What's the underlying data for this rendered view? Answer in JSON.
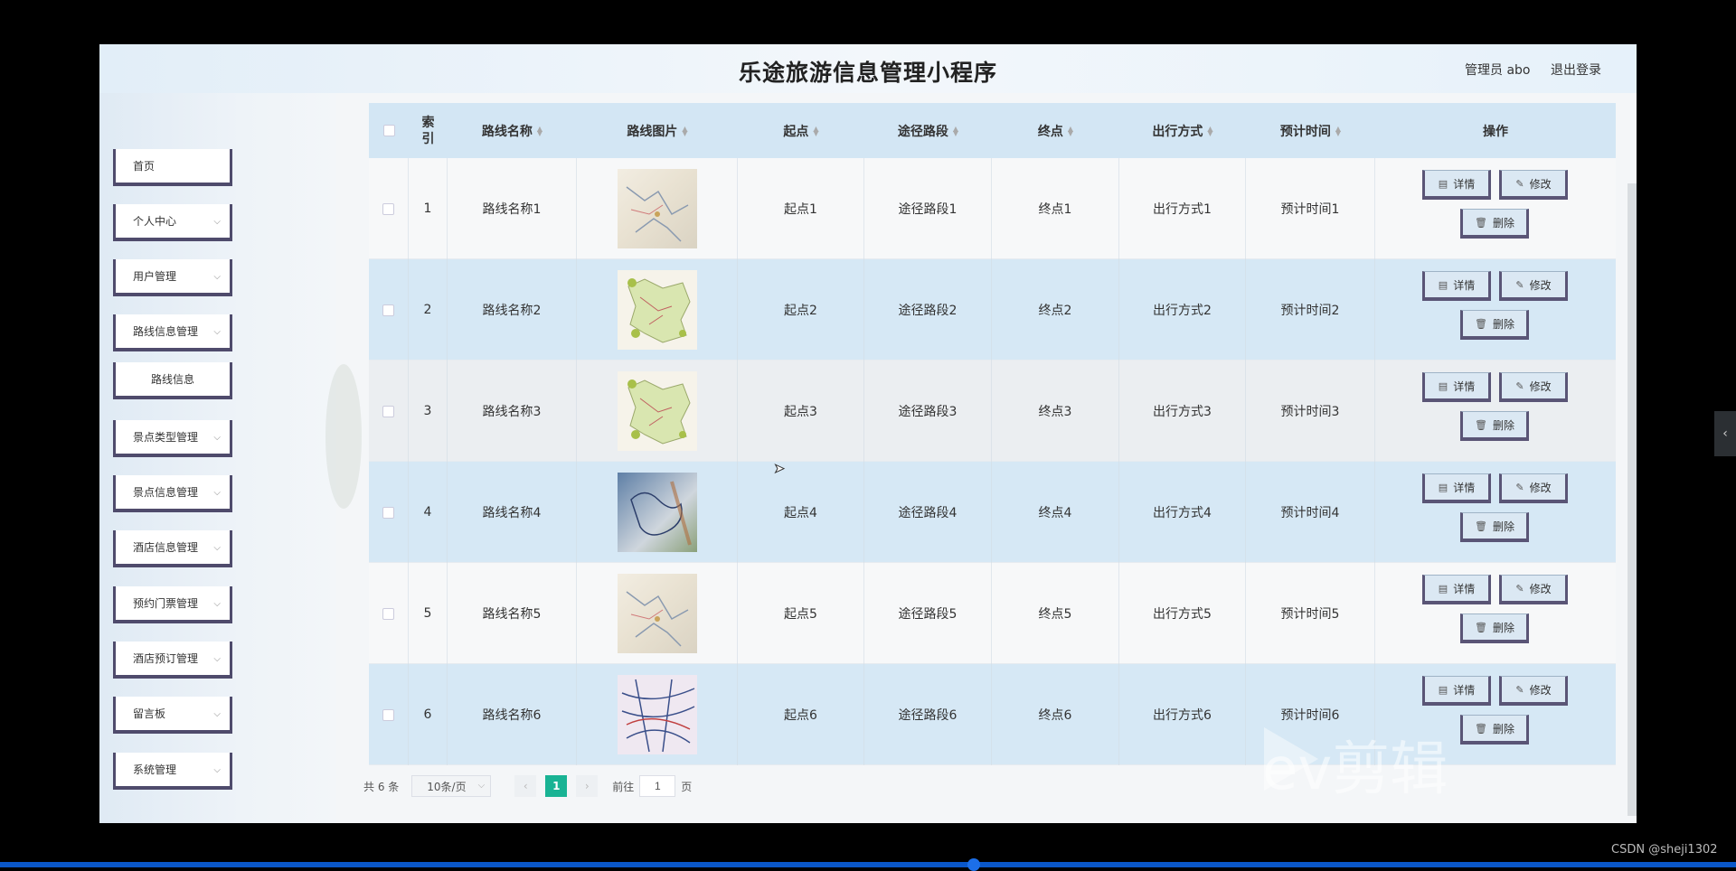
{
  "app_title": "乐途旅游信息管理小程序",
  "header": {
    "admin_label": "管理员 abo",
    "logout_label": "退出登录"
  },
  "sidebar": {
    "items": [
      {
        "label": "首页",
        "has_chevron": false
      },
      {
        "label": "个人中心",
        "has_chevron": true
      },
      {
        "label": "用户管理",
        "has_chevron": true
      },
      {
        "label": "路线信息管理",
        "has_chevron": true
      },
      {
        "label": "路线信息",
        "has_chevron": false,
        "sub": true
      },
      {
        "label": "景点类型管理",
        "has_chevron": true
      },
      {
        "label": "景点信息管理",
        "has_chevron": true
      },
      {
        "label": "酒店信息管理",
        "has_chevron": true
      },
      {
        "label": "预约门票管理",
        "has_chevron": true
      },
      {
        "label": "酒店预订管理",
        "has_chevron": true
      },
      {
        "label": "留言板",
        "has_chevron": true
      },
      {
        "label": "系统管理",
        "has_chevron": true
      }
    ]
  },
  "table": {
    "headers": [
      "索引",
      "路线名称",
      "路线图片",
      "起点",
      "途径路段",
      "终点",
      "出行方式",
      "预计时间",
      "操作"
    ],
    "rows": [
      {
        "index": "1",
        "name": "路线名称1",
        "start": "起点1",
        "via": "途径路段1",
        "end": "终点1",
        "mode": "出行方式1",
        "time": "预计时间1"
      },
      {
        "index": "2",
        "name": "路线名称2",
        "start": "起点2",
        "via": "途径路段2",
        "end": "终点2",
        "mode": "出行方式2",
        "time": "预计时间2"
      },
      {
        "index": "3",
        "name": "路线名称3",
        "start": "起点3",
        "via": "途径路段3",
        "end": "终点3",
        "mode": "出行方式3",
        "time": "预计时间3"
      },
      {
        "index": "4",
        "name": "路线名称4",
        "start": "起点4",
        "via": "途径路段4",
        "end": "终点4",
        "mode": "出行方式4",
        "time": "预计时间4"
      },
      {
        "index": "5",
        "name": "路线名称5",
        "start": "起点5",
        "via": "途径路段5",
        "end": "终点5",
        "mode": "出行方式5",
        "time": "预计时间5"
      },
      {
        "index": "6",
        "name": "路线名称6",
        "start": "起点6",
        "via": "途径路段6",
        "end": "终点6",
        "mode": "出行方式6",
        "time": "预计时间6"
      }
    ],
    "actions": {
      "detail": "详情",
      "edit": "修改",
      "delete": "删除"
    }
  },
  "pagination": {
    "total_text": "共 6 条",
    "page_size": "10条/页",
    "current_page": "1",
    "goto_label": "前往",
    "goto_value": "1",
    "page_unit": "页"
  },
  "overlay": {
    "watermark": "ev剪辑",
    "credit": "CSDN @sheji1302"
  },
  "colors": {
    "accent": "#19b394",
    "header_bg": "#d3e6f4",
    "row_blue": "#d6e8f5",
    "menu_border": "#4f4b6c"
  }
}
